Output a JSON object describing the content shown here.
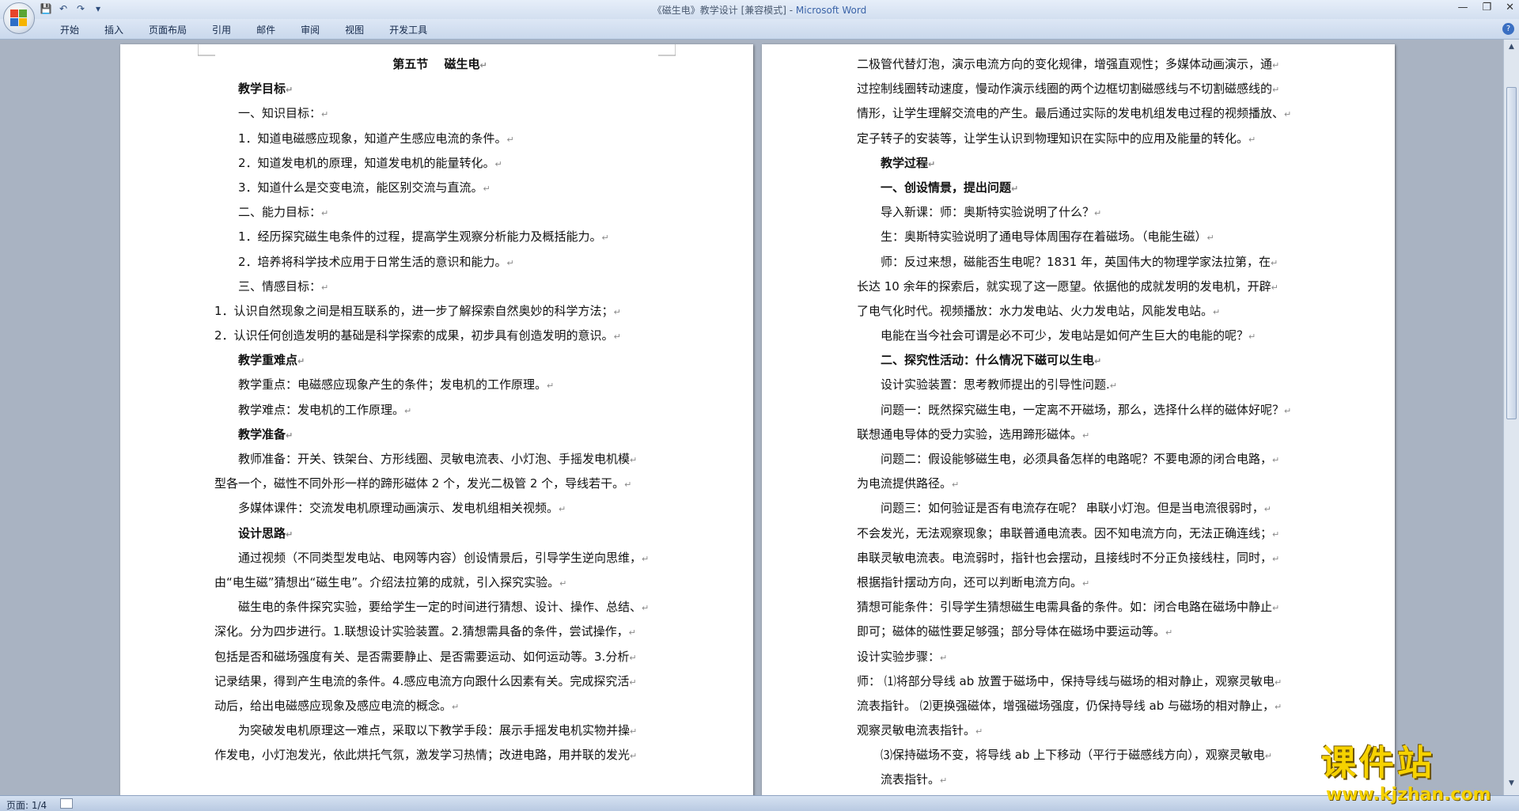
{
  "window": {
    "title_doc": "《磁生电》教学设计 [兼容模式] - ",
    "title_app": "Microsoft Word"
  },
  "ribbon": {
    "tabs": [
      "开始",
      "插入",
      "页面布局",
      "引用",
      "邮件",
      "审阅",
      "视图",
      "开发工具"
    ]
  },
  "page1": {
    "lines": [
      {
        "t": "第五节　 磁生电",
        "cls": "h center",
        "indent": 0
      },
      {
        "t": "教学目标",
        "cls": "h",
        "indent": 1
      },
      {
        "t": "一、知识目标：",
        "cls": "",
        "indent": 1
      },
      {
        "t": "1．知道电磁感应现象，知道产生感应电流的条件。",
        "cls": "",
        "indent": 1
      },
      {
        "t": "2．知道发电机的原理，知道发电机的能量转化。",
        "cls": "",
        "indent": 1
      },
      {
        "t": "3．知道什么是交变电流，能区别交流与直流。",
        "cls": "",
        "indent": 1
      },
      {
        "t": "二、能力目标：",
        "cls": "",
        "indent": 1
      },
      {
        "t": "1．经历探究磁生电条件的过程，提高学生观察分析能力及概括能力。",
        "cls": "",
        "indent": 1
      },
      {
        "t": "2．培养将科学技术应用于日常生活的意识和能力。",
        "cls": "",
        "indent": 1
      },
      {
        "t": "三、情感目标：",
        "cls": "",
        "indent": 1
      },
      {
        "t": "1．认识自然现象之间是相互联系的，进一步了解探索自然奥妙的科学方法；",
        "cls": "",
        "indent": 0
      },
      {
        "t": "2．认识任何创造发明的基础是科学探索的成果，初步具有创造发明的意识。",
        "cls": "",
        "indent": 0
      },
      {
        "t": "教学重难点",
        "cls": "h",
        "indent": 1
      },
      {
        "t": "教学重点：电磁感应现象产生的条件；发电机的工作原理。",
        "cls": "",
        "indent": 1
      },
      {
        "t": "教学难点：发电机的工作原理。",
        "cls": "",
        "indent": 1
      },
      {
        "t": "教学准备",
        "cls": "h",
        "indent": 1
      },
      {
        "t": "教师准备：开关、铁架台、方形线圈、灵敏电流表、小灯泡、手摇发电机模",
        "cls": "",
        "indent": 1
      },
      {
        "t": "型各一个，磁性不同外形一样的蹄形磁体 2 个，发光二极管 2 个，导线若干。",
        "cls": "",
        "indent": 0
      },
      {
        "t": "多媒体课件：交流发电机原理动画演示、发电机组相关视频。",
        "cls": "",
        "indent": 1
      },
      {
        "t": "设计思路",
        "cls": "h",
        "indent": 1
      },
      {
        "t": "通过视频（不同类型发电站、电网等内容）创设情景后，引导学生逆向思维，",
        "cls": "",
        "indent": 1
      },
      {
        "t": "由“电生磁”猜想出“磁生电”。介绍法拉第的成就，引入探究实验。",
        "cls": "",
        "indent": 0
      },
      {
        "t": "磁生电的条件探究实验，要给学生一定的时间进行猜想、设计、操作、总结、",
        "cls": "",
        "indent": 1
      },
      {
        "t": "深化。分为四步进行。1.联想设计实验装置。2.猜想需具备的条件，尝试操作，",
        "cls": "",
        "indent": 0
      },
      {
        "t": "包括是否和磁场强度有关、是否需要静止、是否需要运动、如何运动等。3.分析",
        "cls": "",
        "indent": 0
      },
      {
        "t": "记录结果，得到产生电流的条件。4.感应电流方向跟什么因素有关。完成探究活",
        "cls": "",
        "indent": 0
      },
      {
        "t": "动后，给出电磁感应现象及感应电流的概念。",
        "cls": "",
        "indent": 0
      },
      {
        "t": "为突破发电机原理这一难点，采取以下教学手段：展示手摇发电机实物并操",
        "cls": "",
        "indent": 1
      },
      {
        "t": "作发电，小灯泡发光，依此烘托气氛，激发学习热情；改进电路，用并联的发光",
        "cls": "",
        "indent": 0
      }
    ]
  },
  "page2": {
    "lines": [
      {
        "t": "二极管代替灯泡，演示电流方向的变化规律，增强直观性；多媒体动画演示，通",
        "cls": "",
        "indent": 0
      },
      {
        "t": "过控制线圈转动速度，慢动作演示线圈的两个边框切割磁感线与不切割磁感线的",
        "cls": "",
        "indent": 0
      },
      {
        "t": "情形，让学生理解交流电的产生。最后通过实际的发电机组发电过程的视频播放、",
        "cls": "",
        "indent": 0
      },
      {
        "t": "定子转子的安装等，让学生认识到物理知识在实际中的应用及能量的转化。",
        "cls": "",
        "indent": 0
      },
      {
        "t": "教学过程",
        "cls": "h",
        "indent": 1
      },
      {
        "t": "一、创设情景，提出问题",
        "cls": "h",
        "indent": 1
      },
      {
        "t": "导入新课：师：奥斯特实验说明了什么？",
        "cls": "",
        "indent": 1
      },
      {
        "t": "生：奥斯特实验说明了通电导体周围存在着磁场。（电能生磁）",
        "cls": "",
        "indent": 1
      },
      {
        "t": "师：反过来想，磁能否生电呢？1831 年，英国伟大的物理学家法拉第，在",
        "cls": "",
        "indent": 1
      },
      {
        "t": "长达 10 余年的探索后，就实现了这一愿望。依据他的成就发明的发电机，开辟",
        "cls": "",
        "indent": 0
      },
      {
        "t": "了电气化时代。视频播放：水力发电站、火力发电站，风能发电站。",
        "cls": "",
        "indent": 0
      },
      {
        "t": "电能在当今社会可谓是必不可少，发电站是如何产生巨大的电能的呢？",
        "cls": "",
        "indent": 1
      },
      {
        "t": "二、探究性活动：什么情况下磁可以生电",
        "cls": "h",
        "indent": 1
      },
      {
        "t": "设计实验装置：思考教师提出的引导性问题.",
        "cls": "",
        "indent": 1
      },
      {
        "t": "问题一：既然探究磁生电，一定离不开磁场，那么，选择什么样的磁体好呢？",
        "cls": "",
        "indent": 1
      },
      {
        "t": "联想通电导体的受力实验，选用蹄形磁体。",
        "cls": "",
        "indent": 0
      },
      {
        "t": "问题二：假设能够磁生电，必须具备怎样的电路呢？不要电源的闭合电路，",
        "cls": "",
        "indent": 1
      },
      {
        "t": "为电流提供路径。",
        "cls": "",
        "indent": 0
      },
      {
        "t": "问题三：如何验证是否有电流存在呢？ 串联小灯泡。但是当电流很弱时，",
        "cls": "",
        "indent": 1
      },
      {
        "t": "不会发光，无法观察现象；串联普通电流表。因不知电流方向，无法正确连线；",
        "cls": "",
        "indent": 0
      },
      {
        "t": "串联灵敏电流表。电流弱时，指针也会摆动，且接线时不分正负接线柱，同时，",
        "cls": "",
        "indent": 0
      },
      {
        "t": "根据指针摆动方向，还可以判断电流方向。",
        "cls": "",
        "indent": 0
      },
      {
        "t": "猜想可能条件：引导学生猜想磁生电需具备的条件。如：闭合电路在磁场中静止",
        "cls": "",
        "indent": 0
      },
      {
        "t": "即可；磁体的磁性要足够强；部分导体在磁场中要运动等。",
        "cls": "",
        "indent": 0
      },
      {
        "t": "设计实验步骤：",
        "cls": "",
        "indent": 0
      },
      {
        "t": "师：  ⑴将部分导线 ab 放置于磁场中，保持导线与磁场的相对静止，观察灵敏电",
        "cls": "",
        "indent": 0
      },
      {
        "t": "流表指针。 ⑵更换强磁体，增强磁场强度，仍保持导线 ab 与磁场的相对静止，",
        "cls": "",
        "indent": 0
      },
      {
        "t": "观察灵敏电流表指针。",
        "cls": "",
        "indent": 0
      },
      {
        "t": "⑶保持磁场不变，将导线 ab 上下移动（平行于磁感线方向），观察灵敏电",
        "cls": "",
        "indent": 1
      },
      {
        "t": "流表指针。",
        "cls": "",
        "indent": 1
      }
    ]
  },
  "status": {
    "page": "页面: 1/4"
  },
  "watermark": {
    "text": "课件站",
    "url": "www.kjzhan.com"
  }
}
